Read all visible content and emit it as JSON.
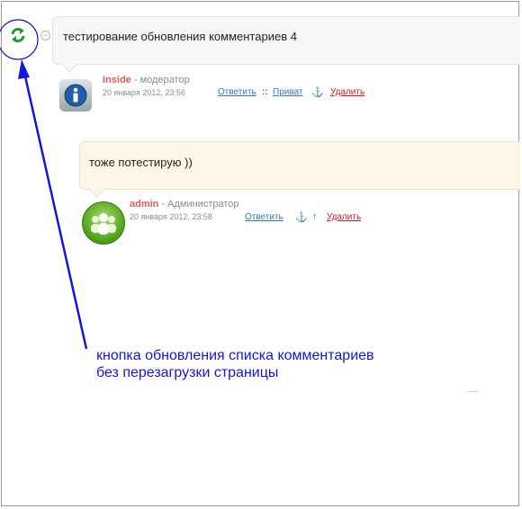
{
  "comments": [
    {
      "text": "тестирование обновления комментариев 4",
      "author": "Inside",
      "role": " - модератор",
      "date": "20 января 2012, 23:56",
      "actions": {
        "reply": "Ответить",
        "separator": "::",
        "private": "Приват",
        "anchor": "⚓",
        "delete": "Удалить"
      },
      "avatar_icon": "info-icon"
    },
    {
      "text": "тоже потестирую ))",
      "author": "admin",
      "role": " - Администратор",
      "date": "20 января 2012, 23:58",
      "actions": {
        "reply": "Ответить",
        "anchor": "⚓",
        "parent": "↑",
        "delete": "Удалить"
      },
      "avatar_icon": "users-group-icon"
    }
  ],
  "refresh_button": {
    "icon": "refresh-icon",
    "accent": "#1a9a2f"
  },
  "collapse_button": {
    "label": "−"
  },
  "annotation": {
    "line1": "кнопка обновления списка комментариев",
    "line2": "без перезагрузки страницы",
    "color": "#1515dd"
  }
}
